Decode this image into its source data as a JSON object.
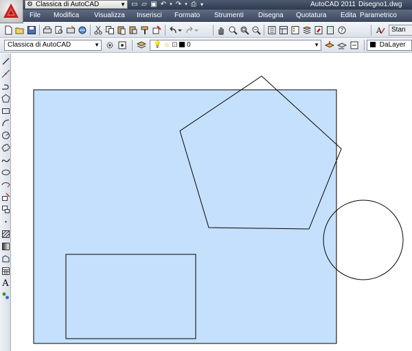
{
  "titlebar": {
    "workspace": "Classica di AutoCAD",
    "app_title": "AutoCAD 2011",
    "document_title": "Disegno1.dwg"
  },
  "menubar": {
    "items": [
      "File",
      "Modifica",
      "Visualizza",
      "Inserisci",
      "Formato",
      "Strumenti",
      "Disegna",
      "Quotatura",
      "Edita",
      "Parametrico"
    ]
  },
  "toolbar2": {
    "workspace_combo": "Classica di AutoCAD",
    "layer_combo": "0",
    "color_combo": "DaLayer"
  },
  "toolbar1": {
    "style_field": "Stan"
  },
  "colors": {
    "hatch_fill": "#c5e0fc",
    "title_bar": "#3a4559",
    "menu_bar": "#4a566d"
  },
  "icons": {
    "draw_toolbar": [
      "line-icon",
      "construction-line-icon",
      "polyline-icon",
      "polygon-icon",
      "rectangle-icon",
      "arc-icon",
      "circle-icon",
      "revision-cloud-icon",
      "spline-icon",
      "ellipse-icon",
      "ellipse-arc-icon",
      "insert-block-icon",
      "make-block-icon",
      "point-icon",
      "hatch-icon",
      "gradient-icon",
      "region-icon",
      "table-icon",
      "multiline-text-icon",
      "add-selected-icon"
    ]
  }
}
